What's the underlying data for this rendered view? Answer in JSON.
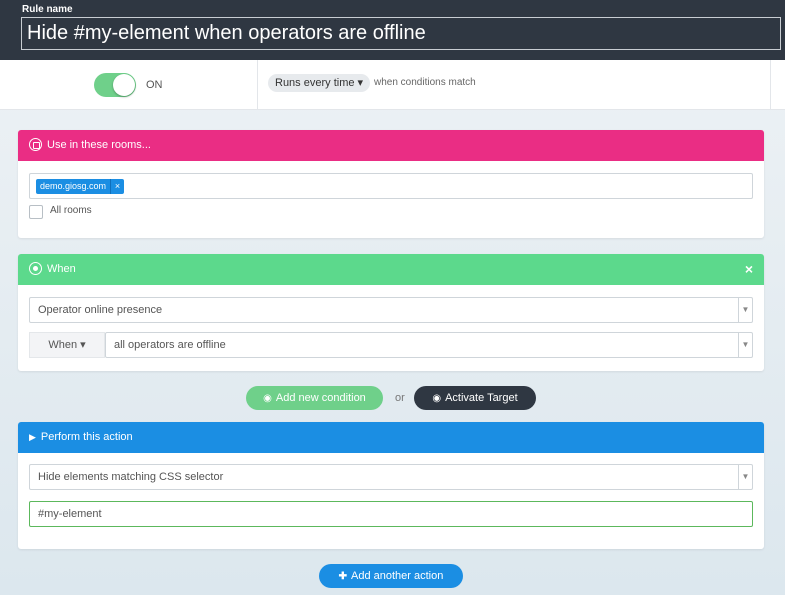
{
  "header": {
    "rule_name_label": "Rule name",
    "rule_name_value": "Hide #my-element when operators are offline"
  },
  "status": {
    "toggle_state": "ON",
    "toggle_on": true,
    "runs_label": "Runs every time ▾",
    "runs_suffix": "when conditions match"
  },
  "rooms": {
    "title": "Use in these rooms...",
    "tags": [
      "demo.giosg.com"
    ],
    "tag_remove": "×",
    "all_rooms_label": "All rooms",
    "all_rooms_checked": false,
    "icon": "room-icon"
  },
  "when": {
    "title": "When",
    "close": "×",
    "condition_type": "Operator online presence",
    "when_dropdown": "When ▾",
    "condition_value": "all operators are offline",
    "icon": "target-icon"
  },
  "condition_buttons": {
    "add_condition": "Add new condition",
    "or": "or",
    "activate_target": "Activate Target"
  },
  "action": {
    "title": "Perform this action",
    "action_type": "Hide elements matching CSS selector",
    "selector_value": "#my-element",
    "icon": "play-icon"
  },
  "add_action_button": "Add another action",
  "colors": {
    "header_bg": "#2f3742",
    "rooms_accent": "#ea2d84",
    "when_accent": "#5cd98c",
    "action_accent": "#1b8ee3",
    "toggle_on": "#6fd08a"
  }
}
